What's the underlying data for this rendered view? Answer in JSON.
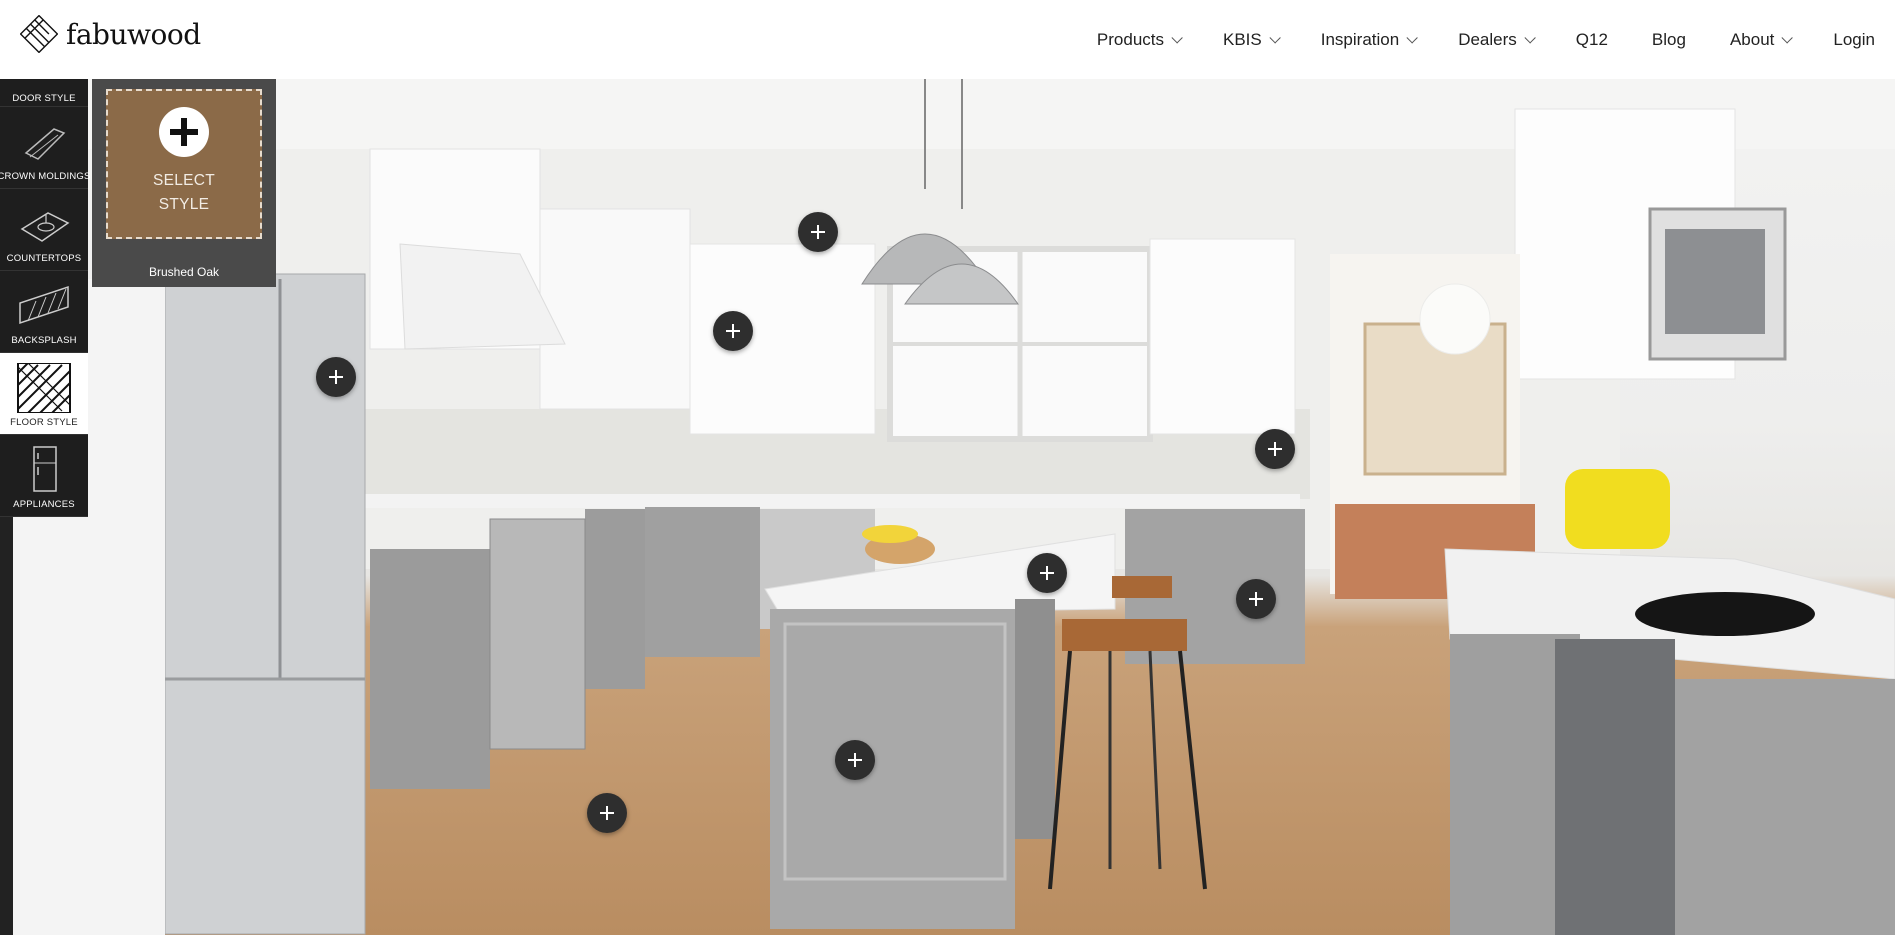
{
  "header": {
    "logo_text": "fabuwood",
    "nav": [
      {
        "label": "Products",
        "has_dropdown": true
      },
      {
        "label": "KBIS",
        "has_dropdown": true
      },
      {
        "label": "Inspiration",
        "has_dropdown": true
      },
      {
        "label": "Dealers",
        "has_dropdown": true
      },
      {
        "label": "Q12",
        "has_dropdown": false
      },
      {
        "label": "Blog",
        "has_dropdown": false
      },
      {
        "label": "About",
        "has_dropdown": true
      },
      {
        "label": "Login",
        "has_dropdown": false
      }
    ]
  },
  "sidebar": {
    "items": [
      {
        "label": "DOOR STYLE",
        "icon": "door-style-icon",
        "active": false
      },
      {
        "label": "CROWN MOLDINGS",
        "icon": "crown-molding-icon",
        "active": false
      },
      {
        "label": "COUNTERTOPS",
        "icon": "countertop-icon",
        "active": false
      },
      {
        "label": "BACKSPLASH",
        "icon": "backsplash-icon",
        "active": false
      },
      {
        "label": "FLOOR STYLE",
        "icon": "floor-style-icon",
        "active": true
      },
      {
        "label": "APPLIANCES",
        "icon": "appliances-icon",
        "active": false
      }
    ]
  },
  "style_panel": {
    "select_line1": "SELECT",
    "select_line2": "STYLE",
    "caption": "Brushed Oak",
    "swatch_color": "#8b6a48"
  },
  "hotspots_count": 9,
  "colors": {
    "header_bg": "#ffffff",
    "sidebar_bg": "#1e1e1e",
    "panel_bg": "#4a4a4a",
    "hotspot_bg": "#2e2e2e",
    "cabinet_gray": "#9a9a9a",
    "floor_oak": "#b98d61"
  }
}
